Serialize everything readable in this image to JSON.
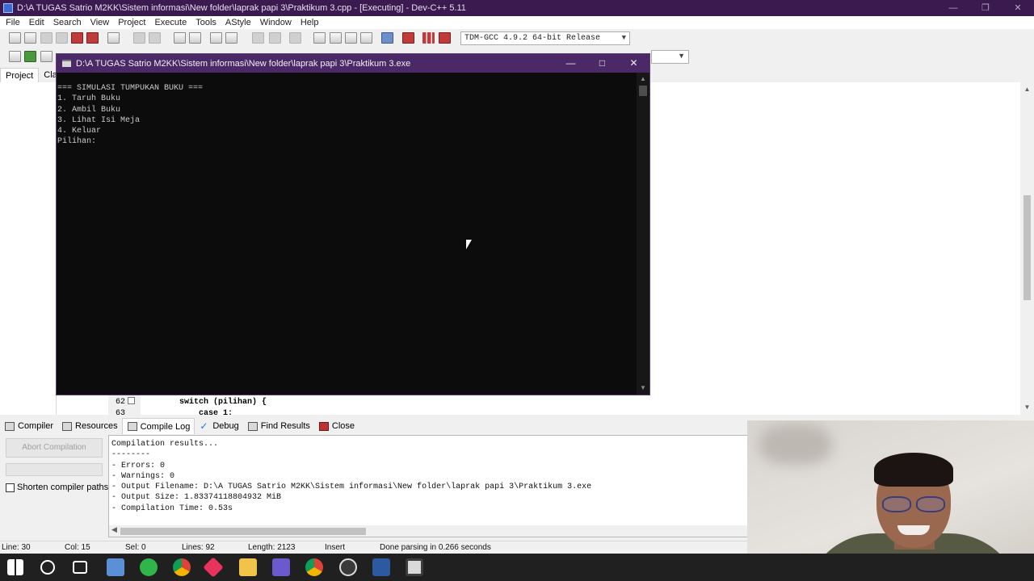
{
  "window": {
    "title": "D:\\A TUGAS Satrio M2KK\\Sistem informasi\\New folder\\laprak papi 3\\Praktikum 3.cpp - [Executing] - Dev-C++ 5.11"
  },
  "menu": [
    "File",
    "Edit",
    "Search",
    "View",
    "Project",
    "Execute",
    "Tools",
    "AStyle",
    "Window",
    "Help"
  ],
  "toolbar": {
    "compiler_select": "TDM-GCC 4.9.2 64-bit Release"
  },
  "left_panel": {
    "tabs": [
      "Project",
      "Class"
    ]
  },
  "console": {
    "title": "D:\\A TUGAS Satrio M2KK\\Sistem informasi\\New folder\\laprak papi 3\\Praktikum 3.exe",
    "output": "=== SIMULASI TUMPUKAN BUKU ===\n1. Taruh Buku\n2. Ambil Buku\n3. Lihat Isi Meja\n4. Keluar\nPilihan: "
  },
  "editor": {
    "visible_lines": [
      {
        "num": "62",
        "code": "switch (pilihan) {"
      },
      {
        "num": "63",
        "code": "case 1:"
      }
    ]
  },
  "bottom_tabs": [
    "Compiler",
    "Resources",
    "Compile Log",
    "Debug",
    "Find Results",
    "Close"
  ],
  "compile_panel": {
    "abort_label": "Abort Compilation",
    "shorten_label": "Shorten compiler paths",
    "log": "Compilation results...\n--------\n- Errors: 0\n- Warnings: 0\n- Output Filename: D:\\A TUGAS Satrio M2KK\\Sistem informasi\\New folder\\laprak papi 3\\Praktikum 3.exe\n- Output Size: 1.83374118804932 MiB\n- Compilation Time: 0.53s"
  },
  "status": {
    "line": "Line:   30",
    "col": "Col:   15",
    "sel": "Sel:   0",
    "lines": "Lines:   92",
    "length": "Length:  2123",
    "mode": "Insert",
    "message": "Done parsing in 0.266 seconds"
  }
}
